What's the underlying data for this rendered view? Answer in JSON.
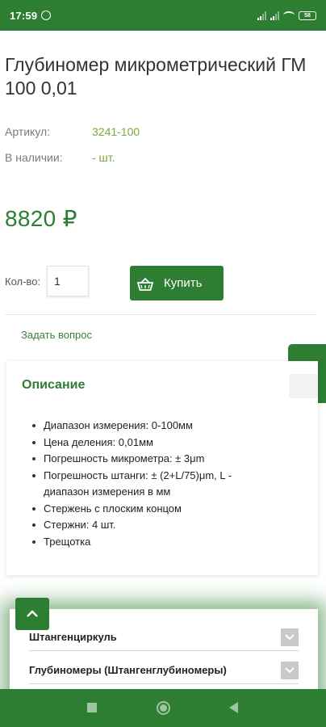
{
  "status_bar": {
    "time": "17:59",
    "battery": "58"
  },
  "product": {
    "title": "Глубиномер микрометрический ГМ 100 0,01",
    "article_label": "Артикул:",
    "article_value": "3241-100",
    "stock_label": "В наличии:",
    "stock_value": "- шт.",
    "price": "8820 ₽"
  },
  "purchase": {
    "qty_label": "Кол-во:",
    "qty_value": "1",
    "buy_label": "Купить"
  },
  "ask_question": "Задать вопрос",
  "description": {
    "title": "Описание",
    "items": [
      "Диапазон измерения: 0-100мм",
      "Цена деления: 0,01мм",
      "Погрешность микрометра: ± 3μm",
      "Погрешность штанги: ± (2+L/75)μm, L - диапазон измерения в мм",
      "Стержень с плоским концом",
      "Стержни: 4 шт.",
      "Трещотка"
    ]
  },
  "categories": [
    "Штангенциркуль",
    "Глубиномеры (Штангенглубиномеры)"
  ],
  "icons": {
    "buy": "basket-icon",
    "cart": "cart-icon",
    "scroll_up": "chevron-up-icon",
    "expand": "chevron-down-icon",
    "alarm": "alarm-icon",
    "nav_recent": "square-icon",
    "nav_home": "circle-icon",
    "nav_back": "triangle-back-icon"
  },
  "colors": {
    "brand": "#2d7d32",
    "accent_value": "#7da836"
  }
}
